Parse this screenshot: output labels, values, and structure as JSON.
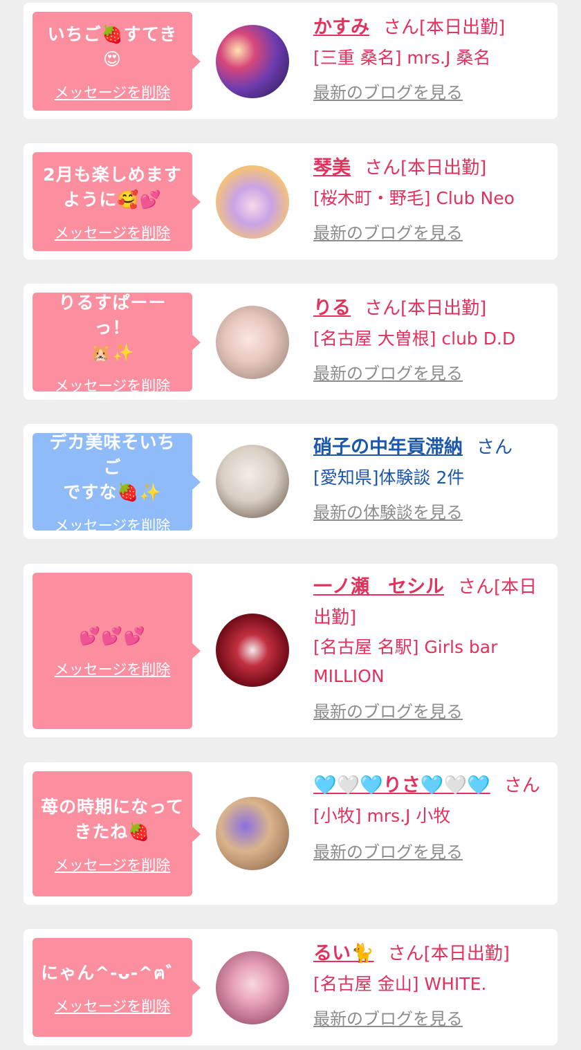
{
  "colors": {
    "pink_bubble": "#fb8fa0",
    "blue_bubble": "#8fbbf8",
    "pink_text": "#e3305c",
    "blue_text": "#1a57ad",
    "gray_link": "#8c8c8c",
    "background": "#eeeeee"
  },
  "delete_label": "メッセージを削除",
  "san": "さん",
  "cards": [
    {
      "message": "いちご🍓すてき\n😍",
      "name": "かすみ",
      "status": "[本日出勤]",
      "shop": "[三重 桑名] mrs.J 桑名",
      "link": "最新のブログを見る"
    },
    {
      "message": "2月も楽しめます\nように🥰💕",
      "name": "琴美",
      "status": "[本日出勤]",
      "shop": "[桜木町・野毛] Club Neo",
      "link": "最新のブログを見る"
    },
    {
      "message": "りるすぱーーっ！\n🐹✨",
      "name": "りる",
      "status": "[本日出勤]",
      "shop": "[名古屋 大曽根] club D.D",
      "link": "最新のブログを見る"
    },
    {
      "message": "デカ美味そいちご\nですな🍓✨",
      "name": "硝子の中年貢滞納",
      "status": "",
      "shop": "[愛知県]体験談 2件",
      "link": "最新の体験談を見る"
    },
    {
      "message": "💕💕💕",
      "name": "一ノ瀬　セシル",
      "status": "[本日出勤]",
      "shop": "[名古屋 名駅] Girls bar MILLION",
      "link": "最新のブログを見る"
    },
    {
      "message": "苺の時期になって\nきたね🍓",
      "name": "🩵🤍🩵りさ🩵🤍🩵",
      "status": "",
      "shop": "[小牧] mrs.J 小牧",
      "link": "最新のブログを見る"
    },
    {
      "message": "にゃん^-ᴗ-^ฅ゛",
      "name": "るい🐈",
      "status": "[本日出勤]",
      "shop": "[名古屋 金山] WHITE.",
      "link": "最新のブログを見る"
    }
  ]
}
